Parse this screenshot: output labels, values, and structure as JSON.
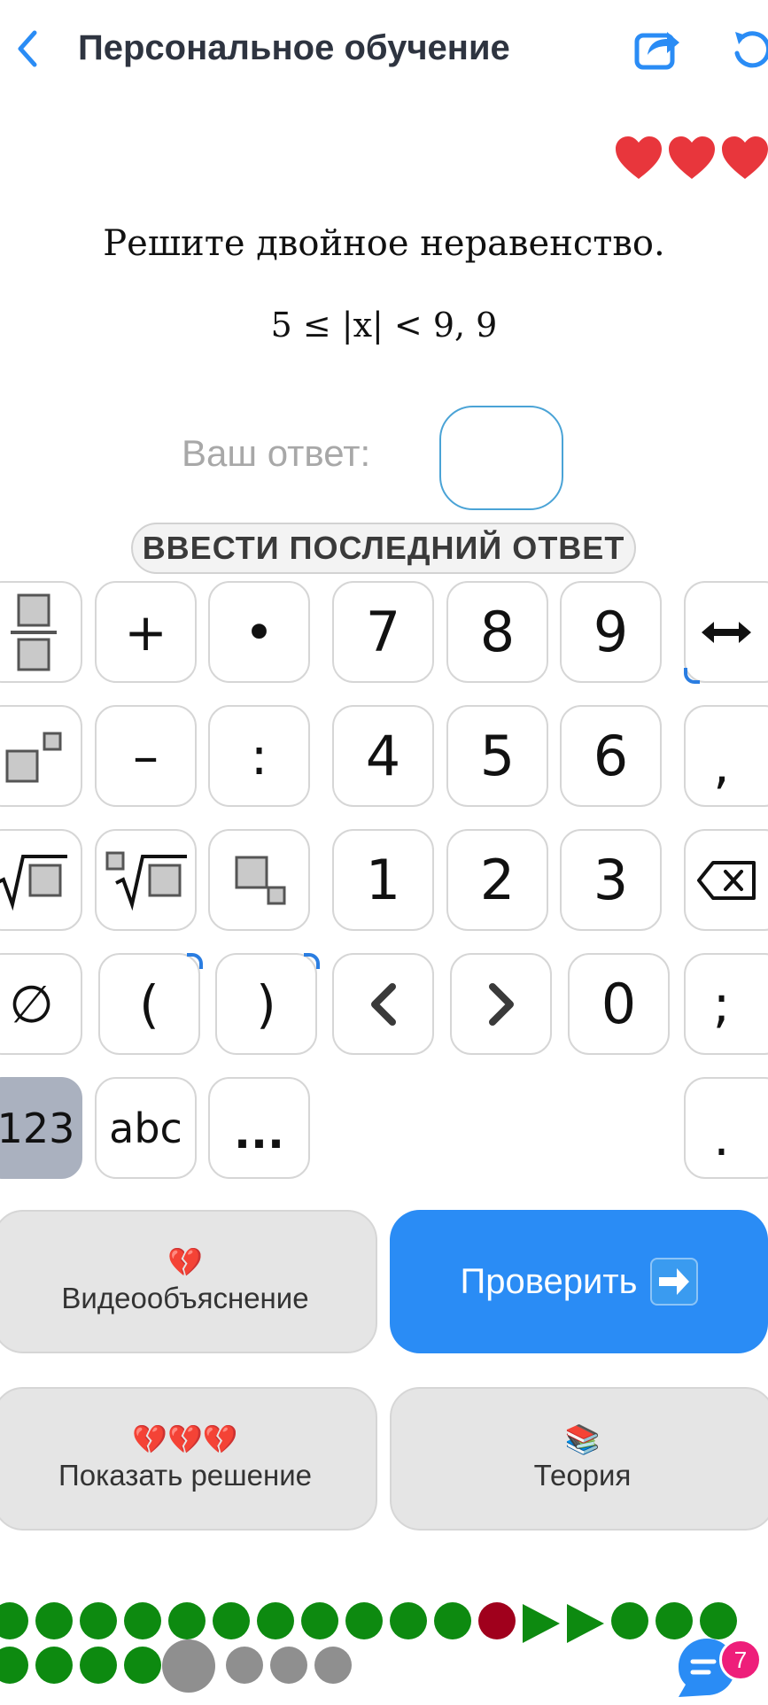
{
  "header": {
    "title": "Персональное обучение",
    "back_icon": "chevron-left-icon",
    "share_icon": "share-icon",
    "refresh_icon": "refresh-icon",
    "accent_color": "#2a8cf5"
  },
  "lives": {
    "count": 3,
    "color": "#e8363c"
  },
  "question": {
    "prompt": "Решите двойное неравенство.",
    "formula": "5 ≤ |x| < 9, 9"
  },
  "answer": {
    "label": "Ваш ответ:",
    "value": "",
    "last_answer_button": "ВВЕСТИ ПОСЛЕДНИЙ ОТВЕТ"
  },
  "keypad": {
    "row1": [
      "fraction",
      "+",
      "•",
      "7",
      "8",
      "9",
      "cursor-swap"
    ],
    "row2": [
      "power",
      "–",
      ":",
      "4",
      "5",
      "6",
      ","
    ],
    "row3": [
      "sqrt",
      "nth-root",
      "subscript",
      "1",
      "2",
      "3",
      "backspace"
    ],
    "row4": [
      "∅",
      "(",
      ")",
      "<",
      ">",
      "0",
      ";"
    ],
    "row5": [
      "123",
      "abc",
      "...",
      "."
    ],
    "labels": {
      "plus": "+",
      "dot": "•",
      "seven": "7",
      "eight": "8",
      "nine": "9",
      "minus": "–",
      "colon": ":",
      "four": "4",
      "five": "5",
      "six": "6",
      "comma": ",",
      "one": "1",
      "two": "2",
      "three": "3",
      "empty_set": "∅",
      "lparen": "(",
      "rparen": ")",
      "lt": "<",
      "gt": ">",
      "zero": "0",
      "semicolon": ";",
      "mode_123": "123",
      "mode_abc": "abc",
      "more": "...",
      "period": "."
    }
  },
  "actions": {
    "video": {
      "label": "Видеообъяснение",
      "emoji": "💔"
    },
    "check": {
      "label": "Проверить",
      "emoji": "➡️"
    },
    "solution": {
      "label": "Показать решение",
      "emoji": "💔💔💔"
    },
    "theory": {
      "label": "Теория",
      "emoji": "📚"
    }
  },
  "progress": {
    "colors": {
      "correct": "#0d8a10",
      "wrong": "#a0001c",
      "pending": "#8f8f8f"
    }
  },
  "chat": {
    "icon": "chat-icon",
    "badge": "7"
  }
}
